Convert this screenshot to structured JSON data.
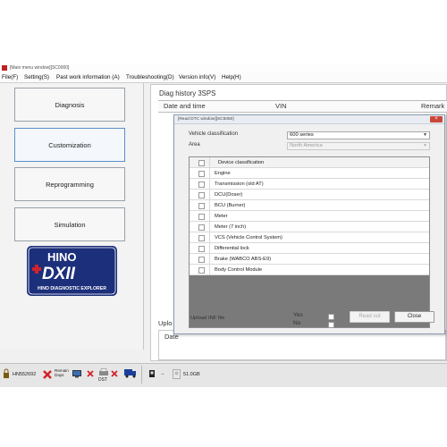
{
  "window": {
    "title": "[Main menu window][SC0000]",
    "menu": [
      "File(F)",
      "Setting(S)",
      "Past work information (A)",
      "Troubleshooting(D)",
      "Version info(V)",
      "Help(H)"
    ]
  },
  "nav": {
    "buttons": [
      "Diagnosis",
      "Customization",
      "Reprogramming",
      "Simulation"
    ],
    "active": "Customization"
  },
  "logo": {
    "brand": "HINO",
    "mark": "DXII",
    "subtitle": "HINO DIAGNOSTIC EXPLORER",
    "colors": {
      "navy": "#1c2f7a",
      "red": "#d2232a"
    }
  },
  "history": {
    "title": "Diag history 3SPS",
    "columns": [
      "Date and time",
      "VIN",
      "Remark"
    ],
    "upload_label": "Uplo",
    "date_label": "Date"
  },
  "dialog": {
    "title": "[Read DTC window][SC5050]",
    "close_symbol": "×",
    "vehicle_label": "Vehicle classification",
    "vehicle_value": "600 series",
    "area_label": "Area",
    "area_value": "North America",
    "list_header": "Device classification",
    "items": [
      "Engine",
      "Transmission (old AT)",
      "DCU(Doser)",
      "BCU (Burner)",
      "Meter",
      "Meter (7 inch)",
      "VCS (Vehicle Control System)",
      "Differential lock",
      "Brake (WABCO ABS-E9)",
      "Body Control Module"
    ],
    "upload_label": "Upload INF file",
    "yes_label": "Yes",
    "no_label": "No",
    "readout_button": "Read out",
    "close_button": "Close"
  },
  "taskbar": {
    "id_text": "HN552692",
    "remain_label": "Remain\nDays",
    "dst_label": "DST",
    "disk_text": "51.0GB"
  },
  "colors": {
    "accent": "#5b8fc9",
    "dialog_close": "#c9473a"
  }
}
